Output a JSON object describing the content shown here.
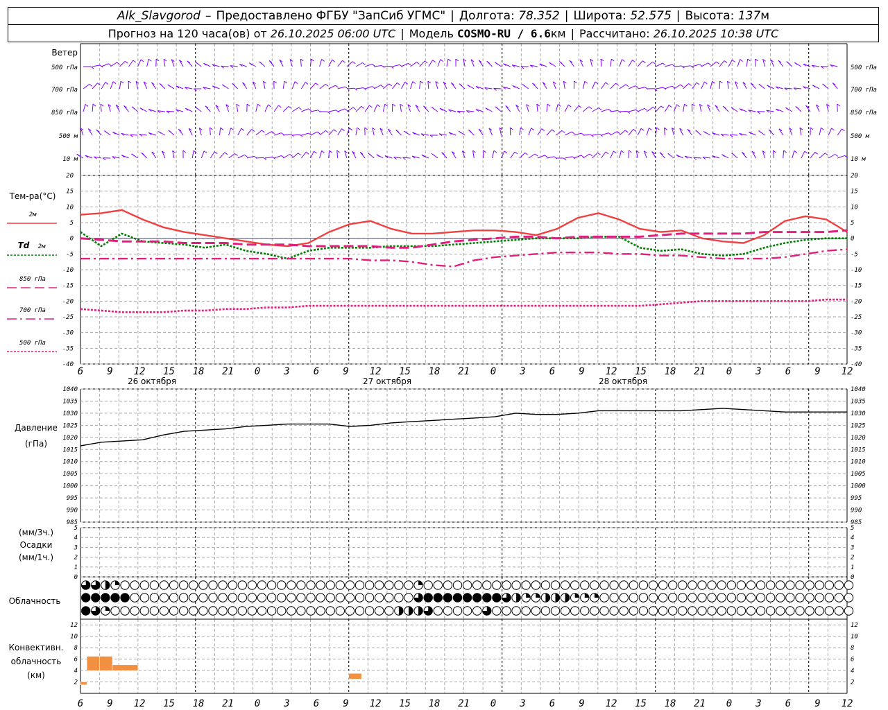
{
  "header": {
    "station": "Alk_Slavgorod",
    "dash": "–",
    "provider": "Предоставлено ФГБУ \"ЗапСиб УГМС\"",
    "lon_label": "Долгота:",
    "lon": "78.352",
    "lat_label": "Широта:",
    "lat": "52.575",
    "alt_label": "Высота:",
    "alt": "137",
    "alt_unit": "м"
  },
  "subheader": {
    "forecast": "Прогноз на 120 часа(ов) от",
    "start": "26.10.2025 06:00 UTC",
    "model_label": "Модель",
    "model": "COSMO-RU / 6.6",
    "model_unit": "км",
    "calc_label": "Рассчитано:",
    "calc": "26.10.2025 10:38 UTC"
  },
  "wind_panel": {
    "title": "Ветер",
    "levels": [
      "500 гПа",
      "700 гПа",
      "850 гПа",
      "500 м",
      "10  м"
    ],
    "color": "#8000ff"
  },
  "x_axis": {
    "ticks": [
      "6",
      "9",
      "12",
      "15",
      "18",
      "21",
      "0",
      "3",
      "6",
      "9",
      "12",
      "15",
      "18",
      "21",
      "0",
      "3",
      "6",
      "9",
      "12",
      "15",
      "18",
      "21",
      "0",
      "3",
      "6",
      "9",
      "12"
    ],
    "day_labels": [
      "26 октября",
      "27 октября",
      "28 октября"
    ]
  },
  "temp_legend": {
    "title": "Тем-ра(°C)",
    "items": [
      {
        "label": "2м",
        "color": "#f04040"
      },
      {
        "label_italic": "Td",
        "label": "2м",
        "color": "#008000"
      },
      {
        "label": "850 гПа",
        "color": "#e0207f"
      },
      {
        "label": "700 гПа",
        "color": "#e0207f"
      },
      {
        "label": "500 гПа",
        "color": "#e0207f"
      }
    ]
  },
  "pressure_panel": {
    "title": "Давление",
    "unit": "(гПа)"
  },
  "precip_panel": {
    "unit_top": "(мм/3ч.)",
    "title": "Осадки",
    "unit_bottom": "(мм/1ч.)"
  },
  "cloud_panel": {
    "title": "Облачность"
  },
  "conv_panel": {
    "title1": "Конвективн.",
    "title2": "облачность",
    "unit": "(км)",
    "color": "#f09040"
  },
  "chart_data": [
    {
      "type": "line",
      "id": "temperature",
      "title": "Тем-ра(°C)",
      "x_hours": [
        0,
        3,
        6,
        9,
        12,
        15,
        18,
        21,
        24,
        27,
        30,
        33,
        36,
        39,
        42,
        45,
        48,
        51,
        54,
        57,
        60,
        63,
        66,
        69,
        72,
        75,
        78,
        81,
        84,
        87,
        90,
        93,
        96,
        99,
        102,
        105,
        108,
        111,
        114,
        117,
        120
      ],
      "ylim": [
        -40,
        20
      ],
      "yticks": [
        20,
        15,
        10,
        5,
        0,
        -5,
        -10,
        -15,
        -20,
        -25,
        -30,
        -35,
        -40
      ],
      "series": [
        {
          "name": "2м",
          "values": [
            7.5,
            8,
            9,
            6,
            3.5,
            2,
            1,
            0,
            -1,
            -2,
            -2.5,
            -1.5,
            2,
            4.5,
            5.5,
            3,
            1.5,
            1.5,
            2,
            2.5,
            2.5,
            2,
            1,
            3,
            6.5,
            8,
            6,
            3,
            2,
            2.5,
            0,
            -1,
            -1.5,
            1,
            5.5,
            7,
            6,
            2
          ]
        },
        {
          "name": "Td 2м",
          "values": [
            2,
            -2.5,
            1.5,
            -1,
            -1.5,
            -2,
            -3,
            -2,
            -4,
            -5,
            -6.5,
            -4,
            -3,
            -3,
            -3,
            -2.5,
            -2.5,
            -2.5,
            -2,
            -1.5,
            -1,
            -0.5,
            0,
            0,
            0,
            0.5,
            0.5,
            -3,
            -4,
            -3.5,
            -5,
            -5.5,
            -5,
            -3,
            -1.5,
            -0.5,
            0,
            0
          ]
        },
        {
          "name": "850 гПа",
          "values": [
            0,
            -0.5,
            -1,
            -1,
            -1,
            -1.5,
            -1.5,
            -1.5,
            -2,
            -2,
            -2,
            -2.5,
            -2.5,
            -2.5,
            -2.5,
            -3,
            -3,
            -2,
            -1,
            -0.5,
            0,
            0.5,
            0.5,
            0,
            0.5,
            0.5,
            0.5,
            0.5,
            1,
            1.5,
            1.5,
            1.5,
            1.5,
            2,
            2,
            2,
            2,
            2.5
          ]
        },
        {
          "name": "700 гПа",
          "values": [
            -6.5,
            -6.5,
            -6.5,
            -6.5,
            -6.5,
            -6.5,
            -6.5,
            -6.5,
            -6.5,
            -6.5,
            -6.5,
            -6.5,
            -6.5,
            -6.5,
            -7,
            -7,
            -7.5,
            -8.5,
            -9,
            -7,
            -6,
            -5.5,
            -5,
            -4.5,
            -4.5,
            -4.5,
            -5,
            -5,
            -5.5,
            -5.5,
            -6,
            -6.5,
            -6.5,
            -6.5,
            -6,
            -5,
            -4,
            -3.5
          ]
        },
        {
          "name": "500 гПа",
          "values": [
            -22.5,
            -23,
            -23.5,
            -23.5,
            -23.5,
            -23,
            -23,
            -22.5,
            -22.5,
            -22,
            -22,
            -21.5,
            -21.5,
            -21.5,
            -21.5,
            -21.5,
            -21.5,
            -21.5,
            -21.5,
            -21.5,
            -21.5,
            -21.5,
            -21.5,
            -21.5,
            -21.5,
            -21.5,
            -21.5,
            -21.5,
            -21,
            -20.5,
            -20,
            -20,
            -20,
            -20,
            -20,
            -20,
            -19.5,
            -19.5
          ]
        }
      ]
    },
    {
      "type": "line",
      "id": "pressure",
      "title": "Давление",
      "ylabel": "(гПа)",
      "ylim": [
        985,
        1040
      ],
      "yticks": [
        1040,
        1035,
        1030,
        1025,
        1020,
        1015,
        1010,
        1005,
        1000,
        995,
        990,
        985
      ],
      "series": [
        {
          "name": "Давление",
          "values": [
            1016.5,
            1018,
            1018.5,
            1019,
            1021,
            1022.5,
            1023,
            1023.5,
            1024.5,
            1025,
            1025.5,
            1025.5,
            1025.5,
            1024.5,
            1025,
            1026,
            1026.5,
            1027,
            1027.5,
            1028,
            1028.5,
            1030,
            1029.5,
            1029.5,
            1030,
            1031,
            1031,
            1031,
            1031,
            1031,
            1031.5,
            1032,
            1031.5,
            1031,
            1030.5,
            1030.5,
            1030.5,
            1030.5
          ]
        }
      ]
    },
    {
      "type": "bar",
      "id": "precipitation",
      "title": "Осадки",
      "ylim": [
        0,
        5
      ],
      "yticks": [
        5,
        4,
        3,
        2,
        1,
        0
      ],
      "values": []
    },
    {
      "type": "bar",
      "id": "convective_cloud",
      "title": "Конвективн. облачность",
      "ylabel": "(км)",
      "ylim": [
        0,
        12
      ],
      "yticks": [
        12,
        10,
        8,
        6,
        4,
        2
      ],
      "bars": [
        {
          "x_hours": [
            0,
            1
          ],
          "base": 1.5,
          "top": 2
        },
        {
          "x_hours": [
            1,
            3
          ],
          "base": 4,
          "top": 6.5
        },
        {
          "x_hours": [
            3,
            5
          ],
          "base": 4,
          "top": 6.5
        },
        {
          "x_hours": [
            5,
            9
          ],
          "base": 4,
          "top": 5
        },
        {
          "x_hours": [
            42,
            44
          ],
          "base": 2.5,
          "top": 3.5
        }
      ]
    },
    {
      "type": "table",
      "id": "cloudiness",
      "title": "Облачность",
      "rows": [
        [
          3,
          3,
          2,
          1,
          0,
          0,
          0,
          0,
          0,
          0,
          0,
          0,
          0,
          0,
          0,
          0,
          0,
          0,
          0,
          0,
          0,
          0,
          0,
          0,
          0,
          0,
          0,
          0,
          0,
          0,
          0,
          0,
          0,
          0,
          1,
          0,
          0,
          0,
          0,
          0,
          0,
          0,
          0,
          0,
          0,
          0,
          0,
          0,
          0,
          0,
          0,
          0,
          0,
          0,
          0,
          0,
          0,
          0,
          0,
          0,
          0,
          0,
          0,
          0,
          0,
          0,
          0,
          0,
          0,
          0,
          0,
          0,
          0,
          0,
          0,
          0,
          0,
          0,
          0,
          0,
          0,
          0,
          0,
          0,
          0,
          0,
          0,
          0
        ],
        [
          4,
          4,
          4,
          4,
          4,
          0,
          0,
          0,
          0,
          0,
          0,
          0,
          0,
          0,
          0,
          0,
          0,
          0,
          0,
          0,
          0,
          0,
          0,
          0,
          0,
          0,
          0,
          0,
          0,
          0,
          0,
          0,
          0,
          0,
          3,
          4,
          4,
          4,
          4,
          4,
          4,
          4,
          4,
          3,
          2,
          1,
          1,
          2,
          2,
          2,
          1,
          1,
          1,
          0,
          0,
          0,
          0,
          0,
          0,
          0,
          0,
          0,
          0,
          0,
          0,
          0,
          0,
          0,
          0,
          0,
          0,
          0,
          0,
          0,
          0,
          0,
          0,
          0,
          0,
          0,
          0,
          0,
          0,
          0,
          0,
          0,
          0,
          0
        ],
        [
          4,
          3,
          1,
          0,
          0,
          0,
          0,
          0,
          0,
          0,
          0,
          0,
          0,
          0,
          0,
          0,
          0,
          0,
          0,
          0,
          0,
          0,
          0,
          0,
          0,
          0,
          0,
          0,
          0,
          0,
          0,
          0,
          2,
          2,
          2,
          3,
          0,
          0,
          0,
          0,
          0,
          3,
          0,
          0,
          0,
          0,
          0,
          0,
          0,
          0,
          0,
          0,
          0,
          0,
          0,
          0,
          0,
          0,
          0,
          0,
          0,
          0,
          0,
          0,
          0,
          0,
          0,
          0,
          0,
          0,
          0,
          0,
          0,
          0,
          0,
          0,
          0,
          0,
          0,
          0,
          0,
          0,
          0,
          0,
          0,
          0,
          0,
          0
        ]
      ]
    }
  ]
}
